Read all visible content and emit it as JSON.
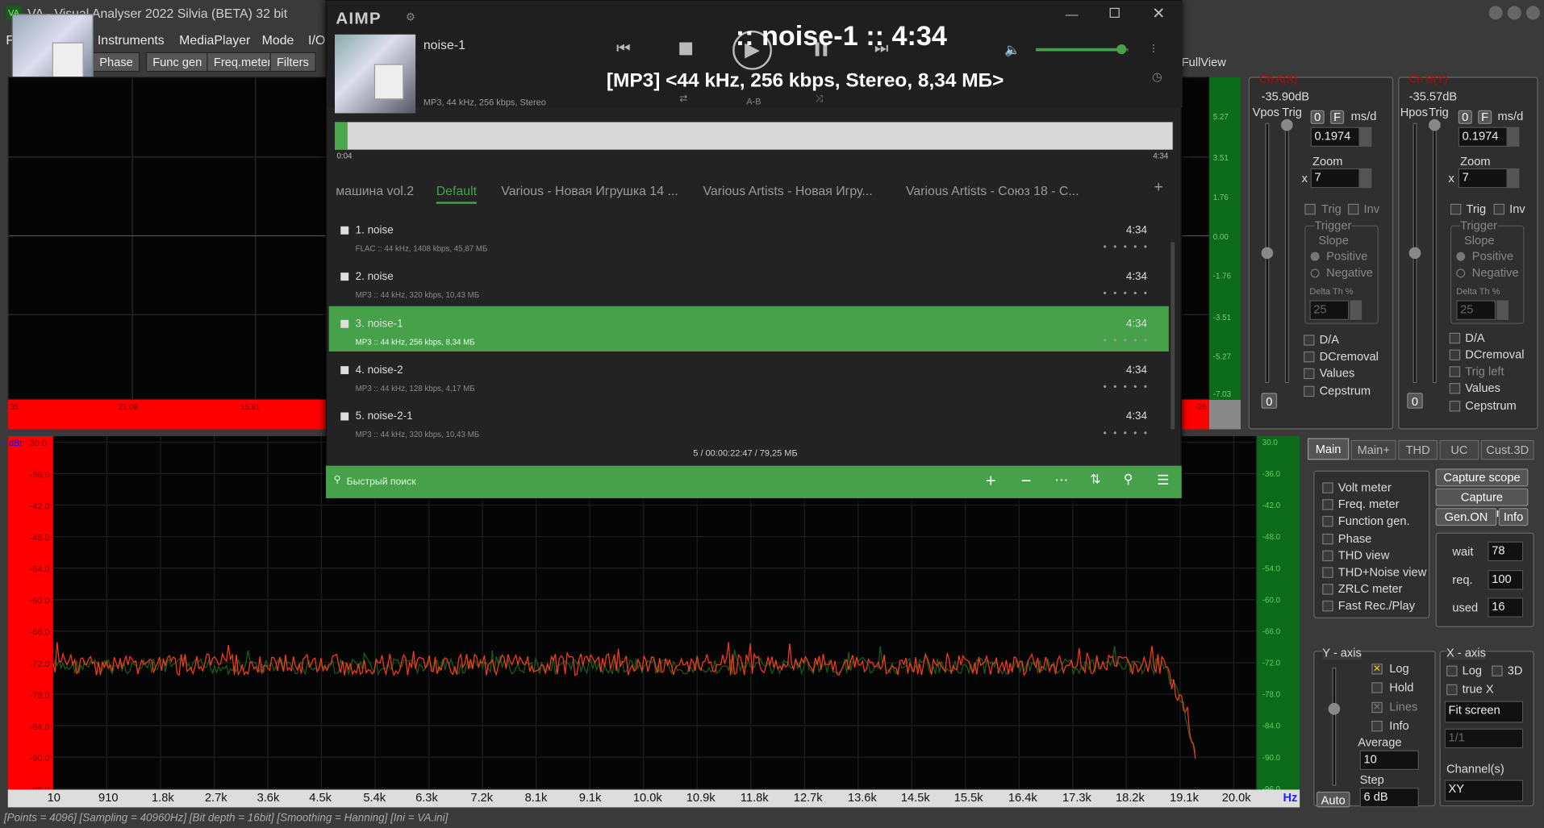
{
  "va": {
    "title": "VA - Visual Analyser 2022 Silvia (BETA) 32 bit",
    "menu": [
      "F",
      "Instruments",
      "MediaPlayer",
      "Mode",
      "I/O"
    ],
    "buttons": [
      "Phase",
      "Func gen",
      "Freq.meter",
      "Filters"
    ],
    "fullview": "FullView",
    "scope_scale_labels": [
      "5.27",
      "3.51",
      "1.76",
      "0.00",
      "-1.76",
      "-3.51",
      "-5.27",
      "-7.03"
    ],
    "scope_red_labels": [
      "35",
      "21.08",
      "15.81",
      "-26"
    ],
    "spec_y_labels": [
      "30.0",
      "-36.0",
      "-42.0",
      "-48.0",
      "-54.0",
      "-60.0",
      "-66.0",
      "-72.0",
      "-78.0",
      "-84.0",
      "-90.0",
      "-96.0"
    ],
    "spec_db_label": "dBr",
    "x_axis": [
      "10",
      "910",
      "1.8k",
      "2.7k",
      "3.6k",
      "4.5k",
      "5.4k",
      "6.3k",
      "7.2k",
      "8.1k",
      "9.1k",
      "10.0k",
      "10.9k",
      "11.8k",
      "12.7k",
      "13.6k",
      "14.5k",
      "15.5k",
      "16.4k",
      "17.3k",
      "18.2k",
      "19.1k",
      "20.0k"
    ],
    "x_unit": "Hz",
    "status": "[Points = 4096] [Sampling = 40960Hz] [Bit depth = 16bit] [Smoothing = Hanning]  [Ini = VA.ini]",
    "chA": {
      "name": "Ch A(X)",
      "db": "-35.90dB",
      "pos_label": "Vpos",
      "trig_label": "Trig",
      "f_label": "F",
      "msd": "ms/d",
      "zero": "0",
      "value": "0.1974",
      "zoom_label": "Zoom",
      "x": "x",
      "zoom": "7",
      "trig": "Trig",
      "inv": "Inv",
      "trigger": "Trigger",
      "slope": "Slope",
      "positive": "Positive",
      "negative": "Negative",
      "delta": "Delta Th %",
      "delta_val": "25",
      "opts": [
        "D/A",
        "DCremoval",
        "Values",
        "Cepstrum"
      ],
      "bottom": "0"
    },
    "chB": {
      "name": "Ch B(Y)",
      "db": "-35.57dB",
      "pos_label": "Hpos",
      "trig_label": "Trig",
      "f_label": "F",
      "msd": "ms/d",
      "zero": "0",
      "value": "0.1974",
      "zoom_label": "Zoom",
      "x": "x",
      "zoom": "7",
      "trig": "Trig",
      "inv": "Inv",
      "trigger": "Trigger",
      "slope": "Slope",
      "positive": "Positive",
      "negative": "Negative",
      "delta": "Delta Th %",
      "delta_val": "25",
      "opts": [
        "D/A",
        "DCremoval",
        "Trig left",
        "Values",
        "Cepstrum"
      ],
      "bottom": "0"
    },
    "main_tabs": [
      "Main",
      "Main+",
      "THD",
      "UC",
      "Cust.3D"
    ],
    "instruments": [
      "Volt meter",
      "Freq. meter",
      "Function gen.",
      "Phase",
      "THD view",
      "THD+Noise view",
      "ZRLC meter",
      "Fast Rec./Play"
    ],
    "right_buttons": [
      "Capture scope",
      "Capture spectrum",
      "Gen.ON",
      "Info"
    ],
    "wait": {
      "label": "wait",
      "value": "78"
    },
    "req": {
      "label": "req.",
      "value": "100"
    },
    "used": {
      "label": "used",
      "value": "16"
    },
    "yaxis": {
      "title": "Y - axis",
      "log": "Log",
      "hold": "Hold",
      "lines": "Lines",
      "info": "Info",
      "average": "Average",
      "average_val": "10",
      "step": "Step",
      "step_val": "6 dB",
      "auto": "Auto"
    },
    "xaxis": {
      "title": "X - axis",
      "log": "Log",
      "three_d": "3D",
      "truex": "true X",
      "fit": "Fit screen",
      "ratio": "1/1",
      "channels": "Channel(s)",
      "channel_val": "XY"
    }
  },
  "aimp": {
    "logo": "AIMP",
    "track_title": "noise-1",
    "track_meta": "MP3, 44 kHz, 256 kbps, Stereo",
    "overlay_title": ":: noise-1 :: 4:34",
    "overlay_info": "[MP3] <44 kHz, 256 kbps, Stereo, 8,34 МБ>",
    "ab": "A-B",
    "pos_start": "0:04",
    "pos_end": "4:34",
    "progress_fraction": 0.015,
    "volume_fraction": 0.93,
    "playlists": [
      "машина vol.2",
      "Default",
      "Various - Новая Игрушка 14 ...",
      "Various Artists - Новая Игру...",
      "Various Artists - Союз 18 - С..."
    ],
    "tracks": [
      {
        "title": "1. noise",
        "meta": "FLAC :: 44 kHz, 1408 kbps, 45,87 МБ",
        "dur": "4:34"
      },
      {
        "title": "2. noise",
        "meta": "MP3 :: 44 kHz, 320 kbps, 10,43 МБ",
        "dur": "4:34"
      },
      {
        "title": "3. noise-1",
        "meta": "MP3 :: 44 kHz, 256 kbps, 8,34 МБ",
        "dur": "4:34"
      },
      {
        "title": "4. noise-2",
        "meta": "MP3 :: 44 kHz, 128 kbps, 4,17 МБ",
        "dur": "4:34"
      },
      {
        "title": "5. noise-2-1",
        "meta": "MP3 :: 44 kHz, 320 kbps, 10,43 МБ",
        "dur": "4:34"
      }
    ],
    "summary": "5 / 00:00:22:47 / 79,25 МБ",
    "search_placeholder": "Быстрый поиск",
    "dots": "• • • • •"
  }
}
